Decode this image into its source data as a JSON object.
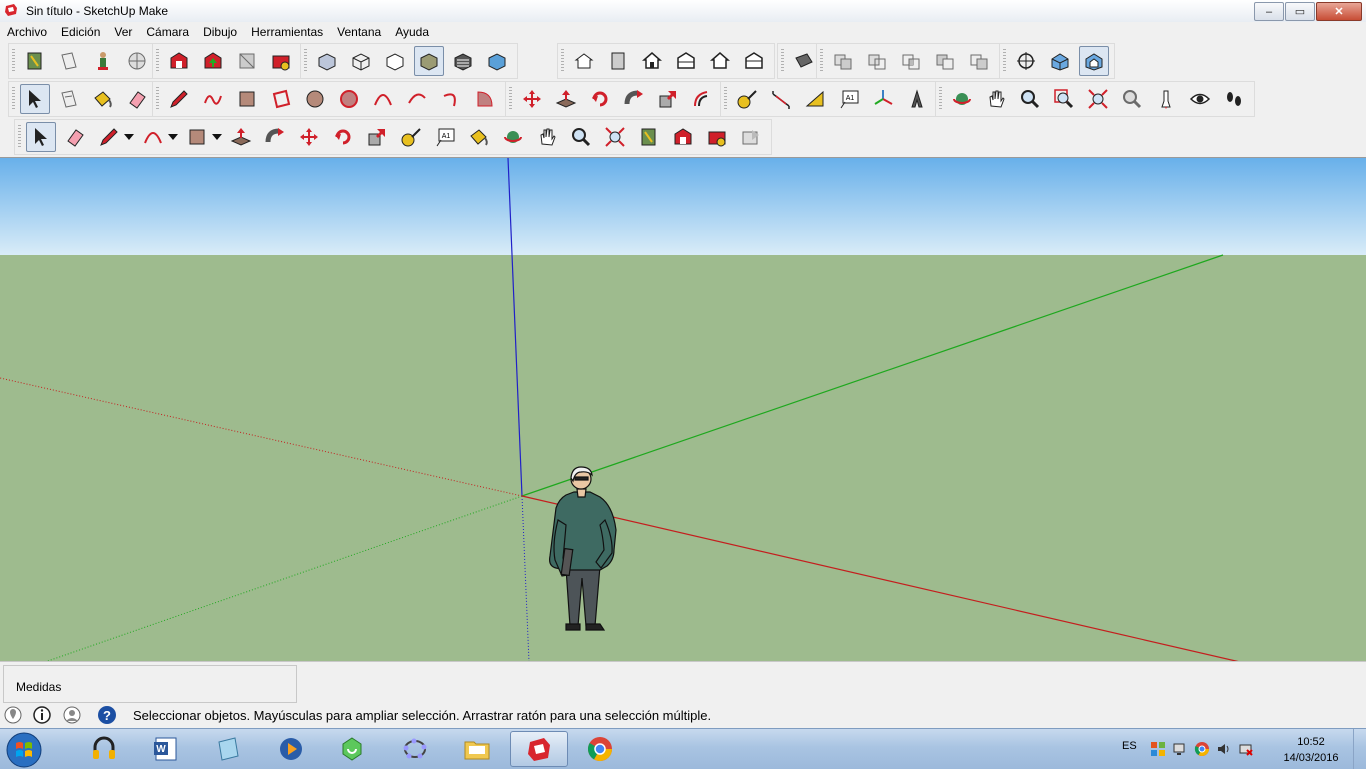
{
  "window": {
    "title": "Sin título - SketchUp Make",
    "buttons": {
      "minimize": "–",
      "maximize": "▭",
      "close": "✕"
    }
  },
  "menu": [
    "Archivo",
    "Edición",
    "Ver",
    "Cámara",
    "Dibujo",
    "Herramientas",
    "Ventana",
    "Ayuda"
  ],
  "toolbar_rows": [
    {
      "groups": [
        [
          "model-info-icon",
          "paper-icon",
          "figure-icon",
          "globe-icon"
        ],
        [
          "warehouse-icon",
          "warehouse-upload-icon",
          "components-icon",
          "extension-warehouse-icon"
        ],
        [
          "xray-icon",
          "wireframe-icon",
          "hidden-line-icon",
          "shaded-icon",
          "shaded-textures-icon",
          "monochrome-icon"
        ],
        [
          "iso-view-icon",
          "top-view-icon",
          "front-view-icon",
          "right-view-icon",
          "back-view-icon",
          "left-view-icon"
        ],
        [
          "section-plane-icon"
        ],
        [
          "union-icon",
          "subtract-icon",
          "intersect-icon",
          "trim-icon",
          "split-icon"
        ],
        [
          "position-camera-icon",
          "perspective-icon",
          "two-point-icon"
        ]
      ]
    },
    {
      "groups": [
        [
          "select-icon",
          "make-component-icon",
          "paint-bucket-icon",
          "eraser-icon"
        ],
        [
          "pencil-icon",
          "freehand-icon",
          "rectangle-icon",
          "rotated-rectangle-icon",
          "circle-icon",
          "polygon-icon",
          "arc-icon",
          "two-point-arc-icon",
          "three-point-arc-icon",
          "pie-icon"
        ],
        [
          "move-icon",
          "push-pull-icon",
          "rotate-icon",
          "follow-me-icon",
          "scale-icon",
          "offset-icon"
        ],
        [
          "tape-measure-icon",
          "dimension-icon",
          "protractor-icon",
          "text-icon",
          "axes-icon",
          "3d-text-icon"
        ],
        [
          "orbit-icon",
          "pan-icon",
          "zoom-icon",
          "zoom-window-icon",
          "zoom-extents-icon",
          "previous-icon",
          "walk-icon",
          "look-around-icon",
          "footprints-icon"
        ]
      ]
    },
    {
      "groups": [
        [
          "select-icon",
          "eraser-icon",
          "pencil-icon",
          "arc-icon",
          "rectangle-icon",
          "push-pull-icon",
          "follow-me-icon",
          "move-icon",
          "rotate-icon",
          "scale-icon",
          "tape-measure-icon",
          "text-icon",
          "paint-bucket-icon",
          "orbit-icon",
          "pan-icon",
          "zoom-icon",
          "zoom-extents-icon",
          "model-info-icon",
          "warehouse-icon",
          "extension-warehouse-icon",
          "share-icon"
        ]
      ]
    }
  ],
  "measurements": {
    "label": "Medidas",
    "value": ""
  },
  "status": {
    "text": "Seleccionar objetos. Mayúsculas para ampliar selección. Arrastrar ratón para una selección múltiple."
  },
  "taskbar": {
    "apps": [
      "headphones-app-icon",
      "word-app-icon",
      "notepad-app-icon",
      "media-app-icon",
      "recycle-app-icon",
      "geogebra-app-icon",
      "folder-app-icon",
      "sketchup-app-icon",
      "chrome-app-icon"
    ],
    "active_app_index": 7,
    "language": "ES",
    "time": "10:52",
    "date": "14/03/2016"
  },
  "colors": {
    "sky_top": "#68b0ea",
    "sky_bottom": "#d9ecf8",
    "ground": "#9ebb8e",
    "red_axis": "#c41e1e",
    "green_axis": "#1ea81e",
    "blue_axis": "#2020c8"
  }
}
